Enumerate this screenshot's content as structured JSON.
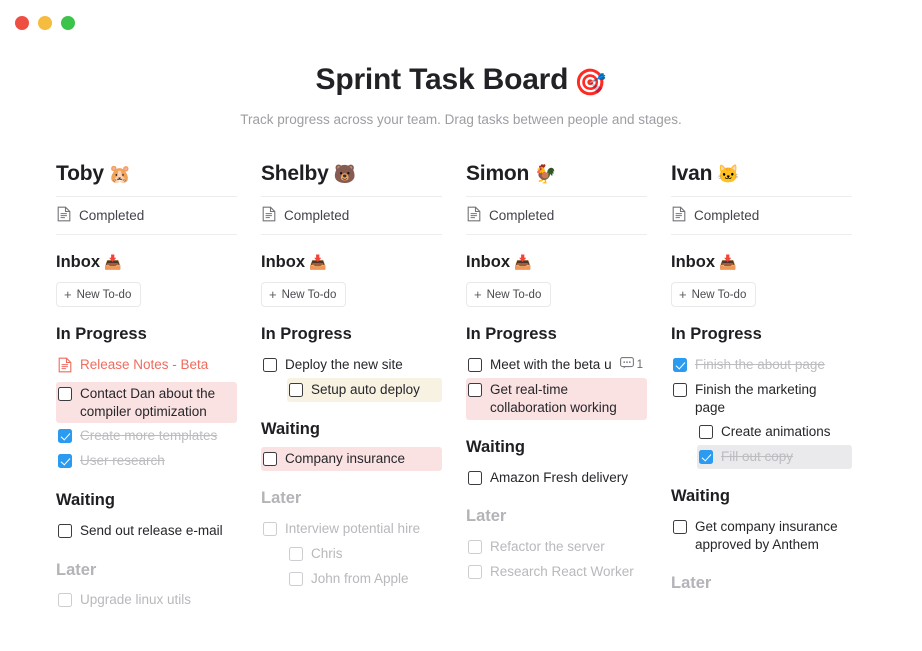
{
  "window": {
    "traffic_lights": [
      "close",
      "minimize",
      "maximize"
    ],
    "colors": {
      "close": "#ef4f43",
      "minimize": "#f5bc3f",
      "maximize": "#3cc44a"
    }
  },
  "header": {
    "title": "Sprint Task Board",
    "title_emoji": "🎯",
    "subtitle": "Track progress across your team.  Drag tasks between people and stages."
  },
  "theme": {
    "accent_checkbox": "#2a9bf0",
    "highlight_pink": "#fbe2e2",
    "highlight_cream": "#f8f2e2",
    "highlight_gray": "#eaeaec",
    "doc_red": "#ef6b5e",
    "muted_text": "#b3b3b8"
  },
  "labels": {
    "completed": "Completed",
    "inbox": "Inbox",
    "inbox_emoji": "📥",
    "new_todo": "New To-do",
    "new_todo_plus": "+",
    "in_progress": "In Progress",
    "waiting": "Waiting",
    "later": "Later"
  },
  "columns": [
    {
      "name": "Toby",
      "emoji": "🐹",
      "in_progress": [
        {
          "text": "Release Notes - Beta",
          "type": "doc",
          "checked": false,
          "indent": 0,
          "highlight": "none",
          "dim": false
        },
        {
          "text": "Contact Dan about the compiler optimization",
          "type": "task",
          "checked": false,
          "indent": 0,
          "highlight": "pink",
          "dim": false
        },
        {
          "text": "Create more templates",
          "type": "task",
          "checked": true,
          "indent": 0,
          "highlight": "none",
          "dim": false
        },
        {
          "text": "User research",
          "type": "task",
          "checked": true,
          "indent": 0,
          "highlight": "none",
          "dim": false
        }
      ],
      "waiting": [
        {
          "text": "Send out release e-mail",
          "type": "task",
          "checked": false,
          "indent": 0,
          "highlight": "none",
          "dim": false
        }
      ],
      "later": [
        {
          "text": "Upgrade linux utils",
          "type": "task",
          "checked": false,
          "indent": 0,
          "highlight": "none",
          "dim": true
        }
      ]
    },
    {
      "name": "Shelby",
      "emoji": "🐻",
      "in_progress": [
        {
          "text": "Deploy the new site",
          "type": "task",
          "checked": false,
          "indent": 0,
          "highlight": "none",
          "dim": false
        },
        {
          "text": "Setup auto deploy",
          "type": "task",
          "checked": false,
          "indent": 1,
          "highlight": "cream",
          "dim": false
        }
      ],
      "waiting": [
        {
          "text": "Company insurance",
          "type": "task",
          "checked": false,
          "indent": 0,
          "highlight": "pink",
          "dim": false
        }
      ],
      "later": [
        {
          "text": "Interview potential hire",
          "type": "task",
          "checked": false,
          "indent": 0,
          "highlight": "none",
          "dim": true
        },
        {
          "text": "Chris",
          "type": "task",
          "checked": false,
          "indent": 1,
          "highlight": "none",
          "dim": true
        },
        {
          "text": "John from Apple",
          "type": "task",
          "checked": false,
          "indent": 1,
          "highlight": "none",
          "dim": true
        }
      ]
    },
    {
      "name": "Simon",
      "emoji": "🐓",
      "in_progress": [
        {
          "text": "Meet with the beta users",
          "type": "task",
          "checked": false,
          "indent": 0,
          "highlight": "none",
          "dim": false,
          "comment_count": "1"
        },
        {
          "text": "Get real-time collaboration working",
          "type": "task",
          "checked": false,
          "indent": 0,
          "highlight": "pink",
          "dim": false
        }
      ],
      "waiting": [
        {
          "text": "Amazon Fresh delivery",
          "type": "task",
          "checked": false,
          "indent": 0,
          "highlight": "none",
          "dim": false
        }
      ],
      "later": [
        {
          "text": "Refactor the server",
          "type": "task",
          "checked": false,
          "indent": 0,
          "highlight": "none",
          "dim": true
        },
        {
          "text": "Research React Worker",
          "type": "task",
          "checked": false,
          "indent": 0,
          "highlight": "none",
          "dim": true
        }
      ]
    },
    {
      "name": "Ivan",
      "emoji": "🐱",
      "in_progress": [
        {
          "text": "Finish the about page",
          "type": "task",
          "checked": true,
          "indent": 0,
          "highlight": "none",
          "dim": false
        },
        {
          "text": "Finish the marketing page",
          "type": "task",
          "checked": false,
          "indent": 0,
          "highlight": "none",
          "dim": false
        },
        {
          "text": "Create animations",
          "type": "task",
          "checked": false,
          "indent": 1,
          "highlight": "none",
          "dim": false
        },
        {
          "text": "Fill out copy",
          "type": "task",
          "checked": true,
          "indent": 1,
          "highlight": "gray",
          "dim": false
        }
      ],
      "waiting": [
        {
          "text": "Get company insurance approved by Anthem",
          "type": "task",
          "checked": false,
          "indent": 0,
          "highlight": "none",
          "dim": false
        }
      ],
      "later": []
    }
  ]
}
